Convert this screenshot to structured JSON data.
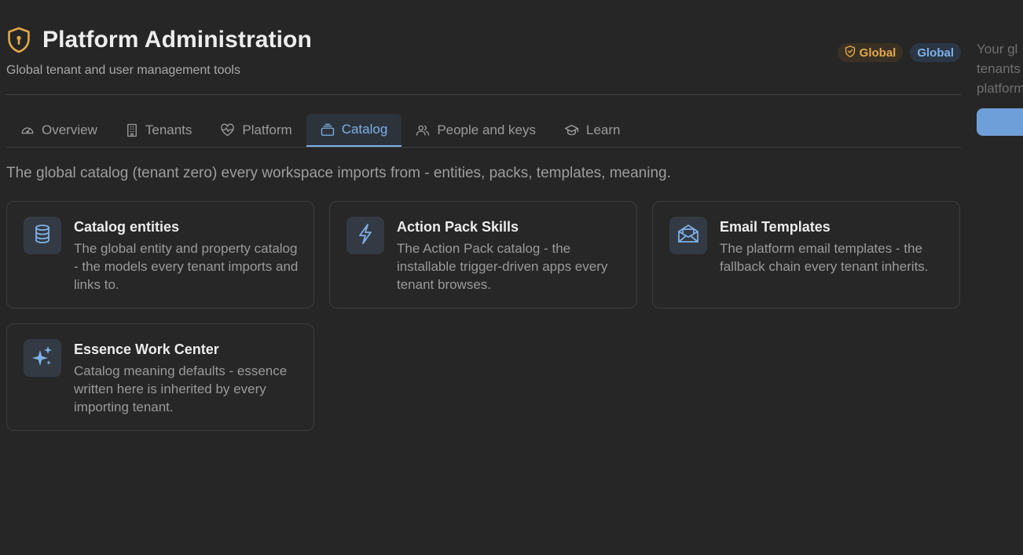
{
  "header": {
    "title": "Platform Administration",
    "subtitle": "Global tenant and user management tools",
    "badges": [
      {
        "label": "Global",
        "icon": "shield-icon",
        "color": "#e2a84b"
      },
      {
        "label": "Global",
        "color": "#7fb0e6"
      }
    ]
  },
  "tabs": [
    {
      "label": "Overview",
      "icon": "gauge-icon"
    },
    {
      "label": "Tenants",
      "icon": "building-icon"
    },
    {
      "label": "Platform",
      "icon": "heart-pulse-icon"
    },
    {
      "label": "Catalog",
      "icon": "layers-icon",
      "active": true
    },
    {
      "label": "People and keys",
      "icon": "users-icon"
    },
    {
      "label": "Learn",
      "icon": "graduation-cap-icon"
    }
  ],
  "catalog": {
    "description": "The global catalog (tenant zero) every workspace imports from - entities, packs, templates, meaning.",
    "cards": [
      {
        "title": "Catalog entities",
        "body": "The global entity and property catalog - the models every tenant imports and links to.",
        "icon": "database-icon"
      },
      {
        "title": "Action Pack Skills",
        "body": "The Action Pack catalog - the installable trigger-driven apps every tenant browses.",
        "icon": "lightning-icon"
      },
      {
        "title": "Email Templates",
        "body": "The platform email templates - the fallback chain every tenant inherits.",
        "icon": "mail-open-icon"
      },
      {
        "title": "Essence Work Center",
        "body": "Catalog meaning defaults - essence written here is inherited by every importing tenant.",
        "icon": "sparkles-icon"
      }
    ]
  },
  "side_panel": {
    "lines": [
      "Your gl",
      "tenants",
      "platform"
    ]
  },
  "colors": {
    "background": "#262626",
    "accent": "#7fb0e6",
    "amber": "#e2a84b"
  }
}
